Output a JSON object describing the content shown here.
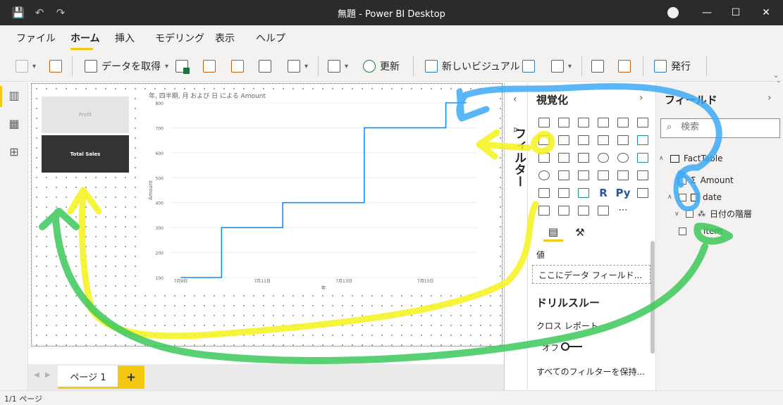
{
  "window": {
    "title": "無題 - Power BI Desktop",
    "controls": {
      "minimize": "—",
      "maximize": "☐",
      "close": "✕"
    }
  },
  "quick_access": {
    "save": "💾",
    "undo": "↶",
    "redo": "↷"
  },
  "menu": {
    "tabs": [
      "ファイル",
      "ホーム",
      "挿入",
      "モデリング",
      "表示",
      "ヘルプ"
    ],
    "active": "ホーム"
  },
  "ribbon": {
    "get_data": "データを取得",
    "refresh": "更新",
    "new_visual": "新しいビジュアル",
    "publish": "発行"
  },
  "canvas": {
    "card_profit": "Profit",
    "card_total_sales": "Total Sales",
    "page_tab": "ページ 1",
    "add_page": "+"
  },
  "chart_data": {
    "type": "line",
    "title": "年, 四半期, 月 および 日 による Amount",
    "xlabel": "年",
    "ylabel": "Amount",
    "x_ticks": [
      "7月9日",
      "7月11日",
      "7月13日",
      "7月15日"
    ],
    "y_ticks": [
      100,
      200,
      300,
      400,
      500,
      600,
      700,
      800
    ],
    "ylim": [
      100,
      800
    ],
    "x_range": [
      8.75,
      16.25
    ],
    "series": [
      {
        "x": [
          9.0,
          10.0,
          10.0,
          11.5,
          11.5,
          13.5,
          13.5,
          15.5,
          15.5,
          16.0
        ],
        "y": [
          100,
          100,
          300,
          300,
          400,
          400,
          700,
          700,
          800,
          800
        ]
      }
    ],
    "colors": {
      "line": "#118dff"
    }
  },
  "filters": {
    "label": "フィルター"
  },
  "visualizations": {
    "title": "視覚化",
    "values_label": "値",
    "values_placeholder": "ここにデータ フィールド...",
    "drillthrough_title": "ドリルスルー",
    "cross_report": "クロス レポート",
    "off": "オフ",
    "keep_filters": "すべてのフィルターを保持..."
  },
  "fields": {
    "title": "フィールド",
    "search_placeholder": "検索",
    "table": "FactTable",
    "items": [
      "Amount",
      "date",
      "日付の階層",
      "item"
    ]
  },
  "status": {
    "page_count": "1/1 ページ"
  },
  "annotations": {
    "blue": "#3da9f5",
    "yellow": "#f5f21b",
    "green": "#3cc85a"
  }
}
